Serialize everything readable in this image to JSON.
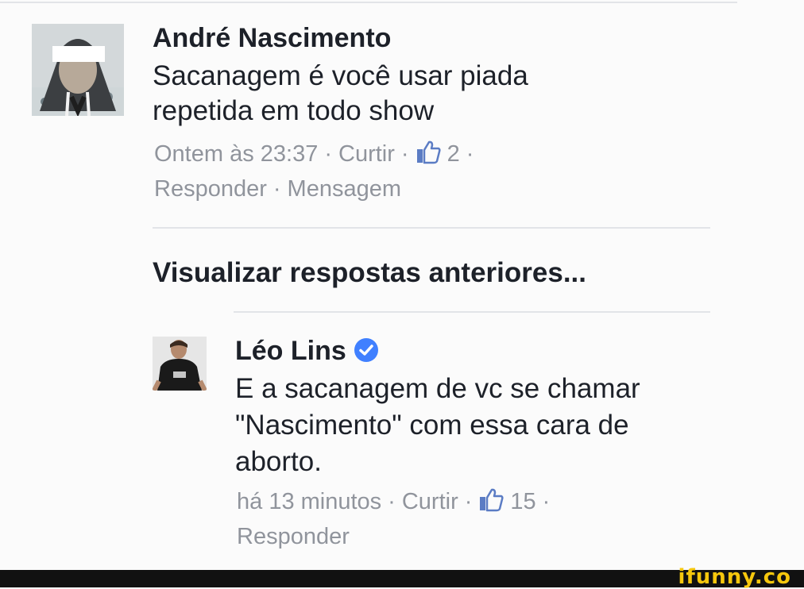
{
  "comments": [
    {
      "author": "André Nascimento",
      "text_lines": [
        "Sacanagem é você usar piada",
        "repetida em todo show"
      ],
      "time": "Ontem às 23:37",
      "like": "Curtir",
      "like_count": "2",
      "reply": "Responder",
      "message": "Mensagem",
      "separator": "·"
    }
  ],
  "view_previous": "Visualizar respostas anteriores...",
  "reply_comment": {
    "author": "Léo Lins",
    "verified": true,
    "text_lines": [
      "E a sacanagem de vc se chamar",
      "\"Nascimento\" com essa cara de",
      "aborto."
    ],
    "time": "há 13 minutos",
    "like": "Curtir",
    "like_count": "15",
    "reply": "Responder",
    "separator": "·"
  },
  "watermark": "ifunny.co",
  "colors": {
    "text": "#1d2129",
    "meta": "#90949c",
    "verified": "#4080ff",
    "footer": "#111111",
    "watermark": "#f6c70d"
  }
}
